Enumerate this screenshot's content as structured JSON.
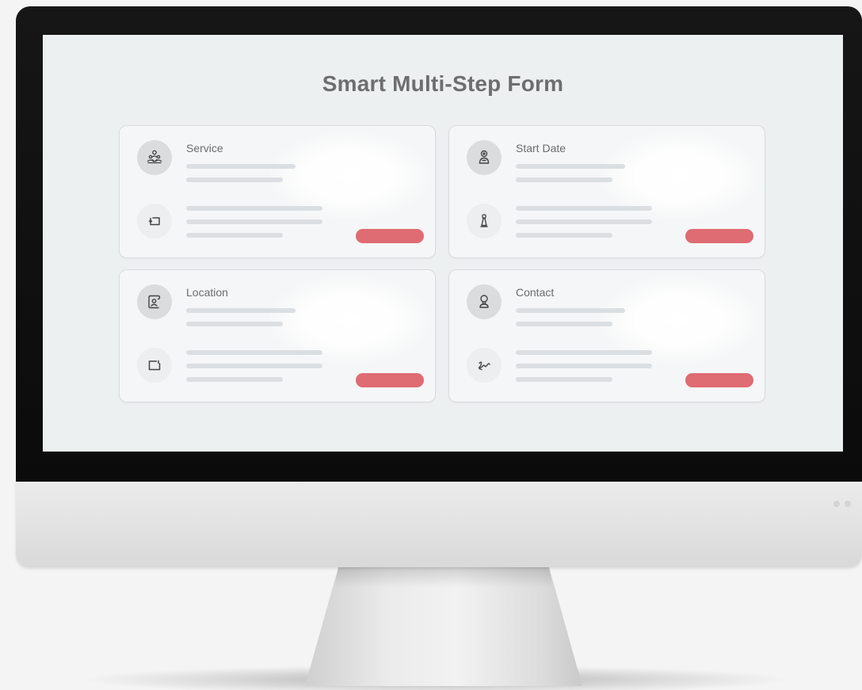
{
  "form": {
    "title": "Smart Multi-Step Form"
  },
  "steps": [
    {
      "label": "Service",
      "primary_icon": "people-group-icon",
      "secondary_icon": "document-corner-icon"
    },
    {
      "label": "Start Date",
      "primary_icon": "person-pin-icon",
      "secondary_icon": "pawn-icon"
    },
    {
      "label": "Location",
      "primary_icon": "map-scroll-icon",
      "secondary_icon": "frame-icon"
    },
    {
      "label": "Contact",
      "primary_icon": "person-badge-icon",
      "secondary_icon": "signature-icon"
    }
  ],
  "colors": {
    "accent_button": "#df6b73",
    "screen_background": "#edf0f1",
    "title_text": "#6d6e70"
  }
}
